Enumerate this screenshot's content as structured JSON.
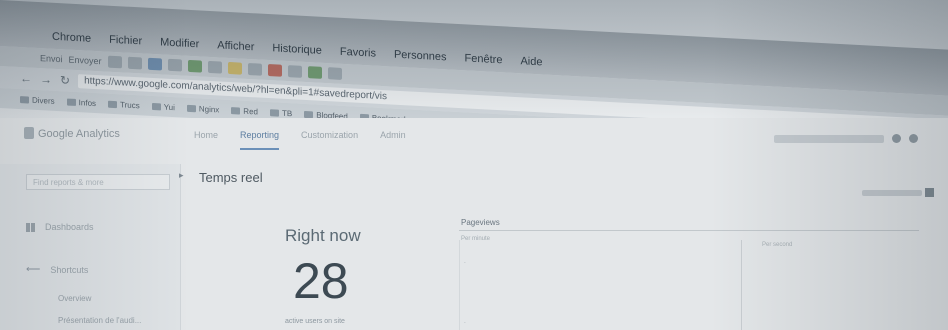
{
  "menubar": {
    "apple": "",
    "items": [
      "Chrome",
      "Fichier",
      "Modifier",
      "Afficher",
      "Historique",
      "Favoris",
      "Personnes",
      "Fenêtre",
      "Aide"
    ]
  },
  "toolbar": {
    "labels": [
      "Envoi",
      "Envoyer"
    ]
  },
  "address": {
    "url": "https://www.google.com/analytics/web/?hl=en&pli=1#savedreport/vis"
  },
  "bookmarks": {
    "items": [
      "Divers",
      "Infos",
      "Trucs",
      "Yui",
      "Nginx",
      "Red",
      "TB",
      "Blogfeed",
      "Bookmarks"
    ]
  },
  "ga": {
    "logo": "Google Analytics",
    "tabs": [
      "Home",
      "Reporting",
      "Customization",
      "Admin"
    ],
    "active_tab": "Reporting"
  },
  "sidebar": {
    "search_placeholder": "Find reports & more",
    "dashboards": "Dashboards",
    "shortcuts": "Shortcuts",
    "overview": "Overview",
    "presentation": "Présentation de l'audi..."
  },
  "main": {
    "page_title": "Temps reel",
    "right_now_label": "Right now",
    "active_users_count": "28",
    "active_users_label": "active users on site",
    "pageviews_label": "Pageviews",
    "per_minute_label": "Per minute",
    "per_second_label": "Per second"
  }
}
